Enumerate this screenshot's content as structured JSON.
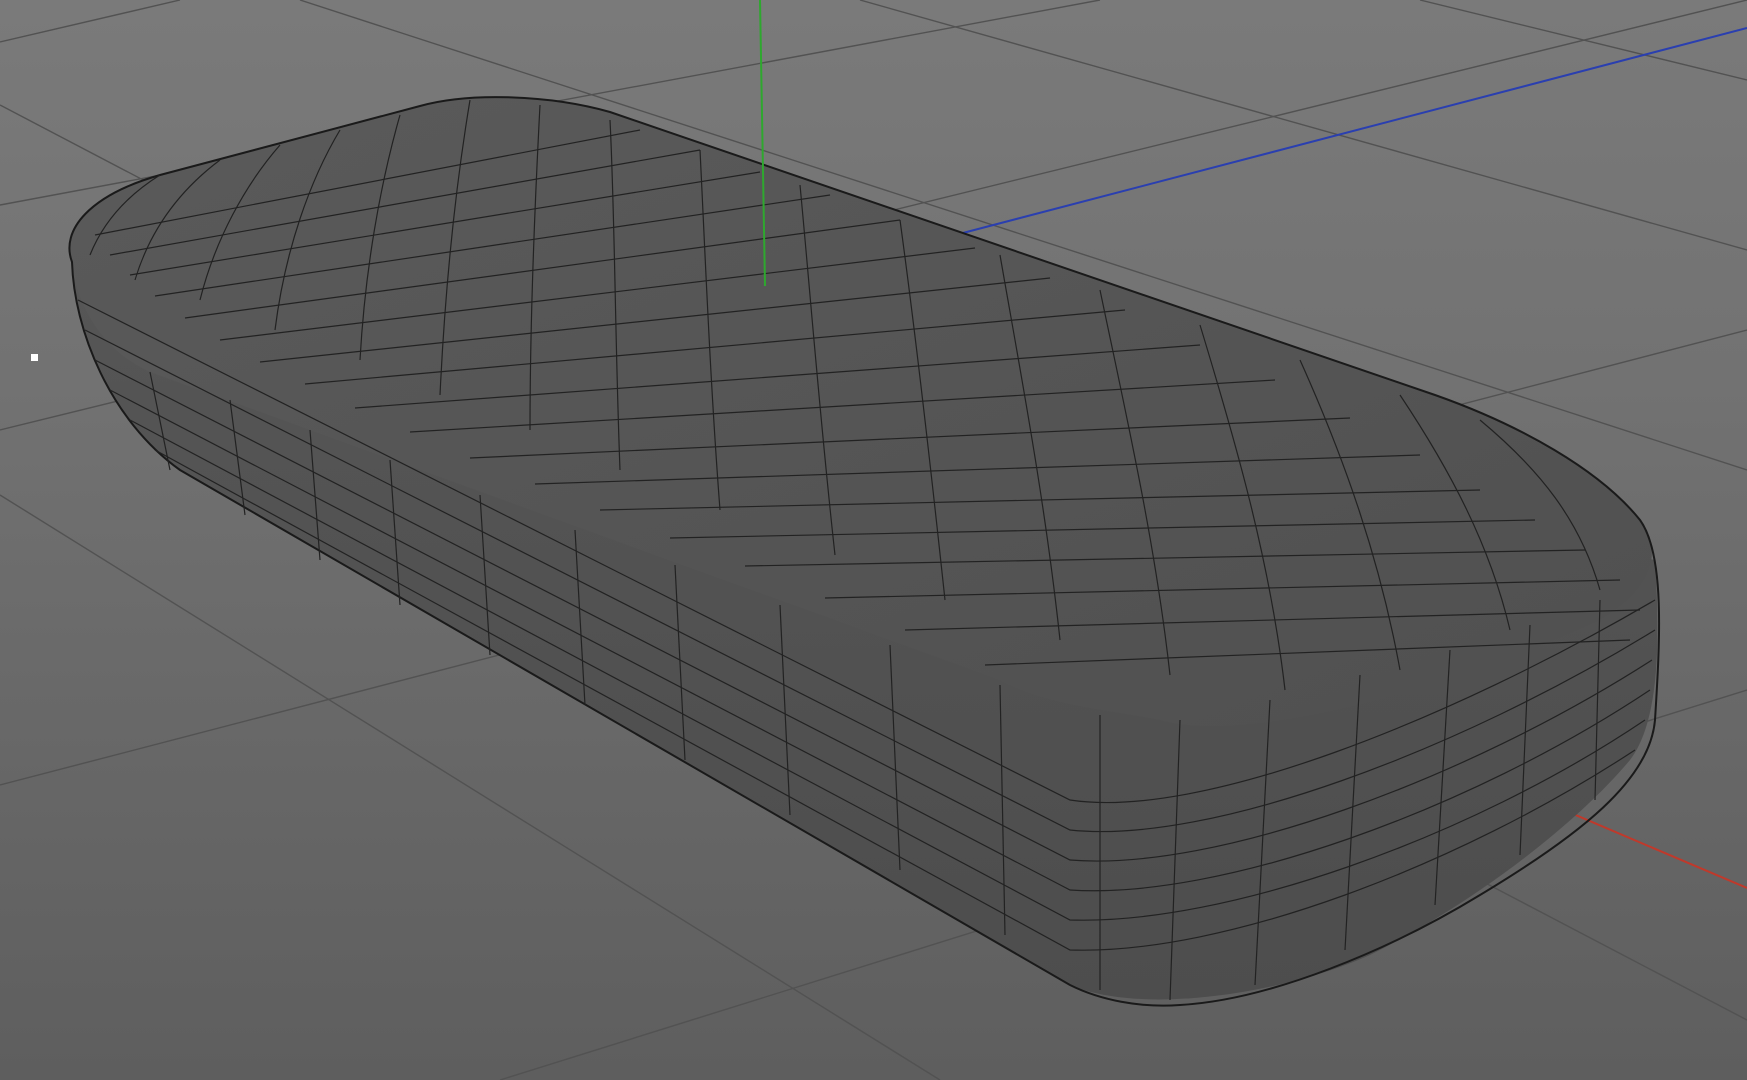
{
  "viewport": {
    "background_top": "#7a7a7a",
    "background_bottom": "#5e5e5e",
    "grid_color": "#545454",
    "mesh_fill": "#555555",
    "mesh_wire": "#1e1e1e",
    "axes": {
      "x_color": "#c0392b",
      "y_color": "#2ea82e",
      "z_color": "#2a3fb0"
    }
  },
  "object": {
    "icon": "rounded-box-mesh-icon"
  }
}
